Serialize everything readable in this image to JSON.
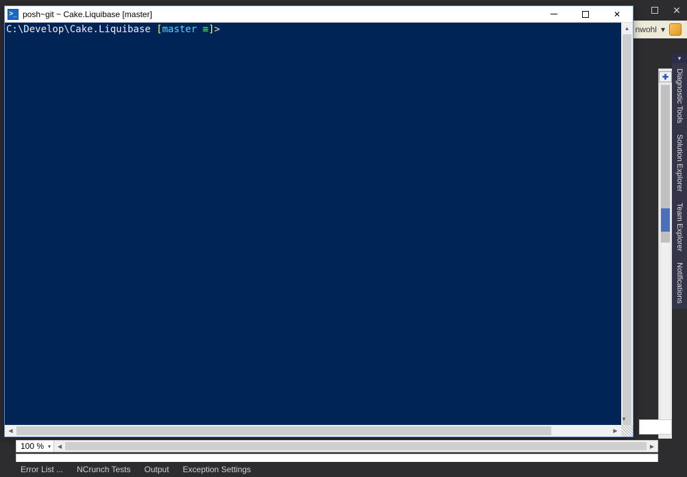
{
  "vs": {
    "user_label": "nwohl",
    "right_tabs": [
      "Diagnostic Tools",
      "Solution Explorer",
      "Team Explorer",
      "Notifications"
    ],
    "zoom": "100 %",
    "tool_tabs": [
      "Error List ...",
      "NCrunch Tests",
      "Output",
      "Exception Settings"
    ]
  },
  "powershell": {
    "title": "posh~git ~ Cake.Liquibase [master]",
    "prompt": {
      "path": "C:\\Develop\\Cake.Liquibase ",
      "lbracket": "[",
      "branch": "master ",
      "equiv": "≡",
      "rbracket": "]",
      "suffix": ">"
    }
  },
  "icons": {
    "ps": ">_",
    "caret_down": "▾",
    "tri_left": "◀",
    "tri_right": "▶",
    "tri_up": "▲",
    "tri_down": "▼",
    "x": "✕"
  }
}
